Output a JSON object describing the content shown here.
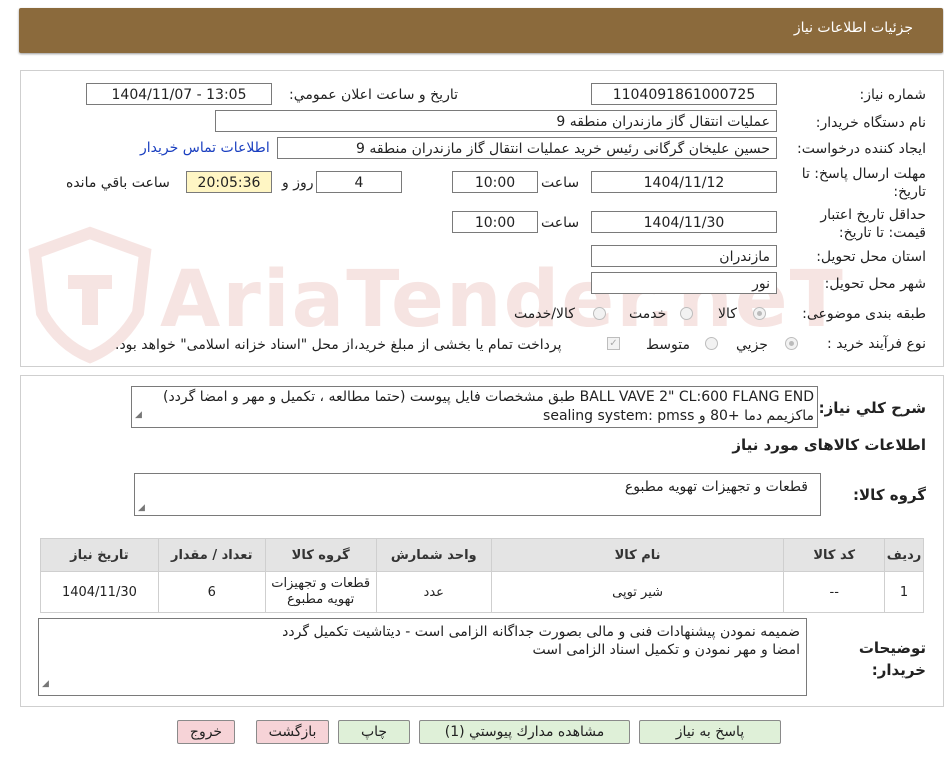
{
  "header": {
    "title": "جزئیات اطلاعات نیاز"
  },
  "form": {
    "need_number_label": "شماره نیاز:",
    "need_number": "1104091861000725",
    "announce_label": "تاریخ و ساعت اعلان عمومي:",
    "announce_value": "1404/11/07 - 13:05",
    "buyer_org_label": "نام دستگاه خریدار:",
    "buyer_org": "عملیات انتقال گاز مازندران منطقه 9",
    "requester_label": "ایجاد کننده درخواست:",
    "requester": "حسین علیخان گرگانی رئیس خرید عملیات انتقال گاز مازندران منطقه 9",
    "contact_link": "اطلاعات تماس خریدار",
    "deadline_label": "مهلت ارسال پاسخ: تا تاریخ:",
    "deadline_date": "1404/11/12",
    "time_label": "ساعت",
    "deadline_time": "10:00",
    "days_value": "4",
    "days_label": "روز و",
    "remaining_time": "20:05:36",
    "remaining_label": "ساعت باقي مانده",
    "validity_label": "حداقل تاریخ اعتبار قیمت: تا تاریخ:",
    "validity_date": "1404/11/30",
    "validity_time": "10:00",
    "province_label": "استان محل تحویل:",
    "province": "مازندران",
    "city_label": "شهر محل تحویل:",
    "city": "نور",
    "category_label": "طبقه بندی موضوعی:",
    "category_options": [
      "کالا",
      "خدمت",
      "کالا/خدمت"
    ],
    "process_label": "نوع فرآیند خرید :",
    "process_options": [
      "جزیي",
      "متوسط"
    ],
    "payment_note": "پرداخت تمام یا بخشی از مبلغ خرید،از محل \"اسناد خزانه اسلامی\" خواهد بود."
  },
  "description": {
    "label": "شرح کلي نياز:",
    "line1": "BALL VAVE 2\" CL:600 FLANG END طبق مشخصات فایل پیوست (حتما مطالعه ، تکمیل و مهر و امضا گردد)",
    "line2": "ماکزیمم دما +80 و sealing system: pmss"
  },
  "goods": {
    "section_title": "اطلاعات کالاهای مورد نیاز",
    "group_label": "گروه کالا:",
    "group_value": "قطعات و تجهیزات تهویه مطبوع"
  },
  "table": {
    "headers": [
      "ردیف",
      "کد کالا",
      "نام کالا",
      "واحد شمارش",
      "گروه کالا",
      "تعداد / مقدار",
      "تاریخ نیاز"
    ],
    "rows": [
      [
        "1",
        "--",
        "شیر توپی",
        "عدد",
        "قطعات و تجهیزات تهویه مطبوع",
        "6",
        "1404/11/30"
      ]
    ]
  },
  "buyer_notes": {
    "label": "توضیحات خریدار:",
    "line1": "ضمیمه نمودن پیشنهادات فنی و مالی بصورت جداگانه الزامی است - دیتاشیت تکمیل گردد",
    "line2": "امضا و مهر نمودن و تکمیل اسناد الزامی است"
  },
  "buttons": {
    "reply": "پاسخ به نیاز",
    "attachments": "مشاهده مدارك پیوستي (1)",
    "print": "چاپ",
    "back": "بازگشت",
    "exit": "خروج"
  },
  "watermark": {
    "text": "AriaTender.neT"
  }
}
